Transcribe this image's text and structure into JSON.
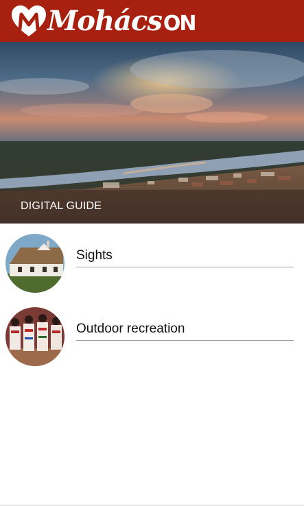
{
  "header": {
    "brand_main": "Mohács",
    "brand_suffix": "ON",
    "background_color": "#a8200f"
  },
  "hero": {
    "title": "DIGITAL GUIDE"
  },
  "menu": {
    "items": [
      {
        "label": "Sights",
        "icon": "farmhouse-photo"
      },
      {
        "label": "Outdoor recreation",
        "icon": "folk-dancers-photo"
      }
    ]
  }
}
